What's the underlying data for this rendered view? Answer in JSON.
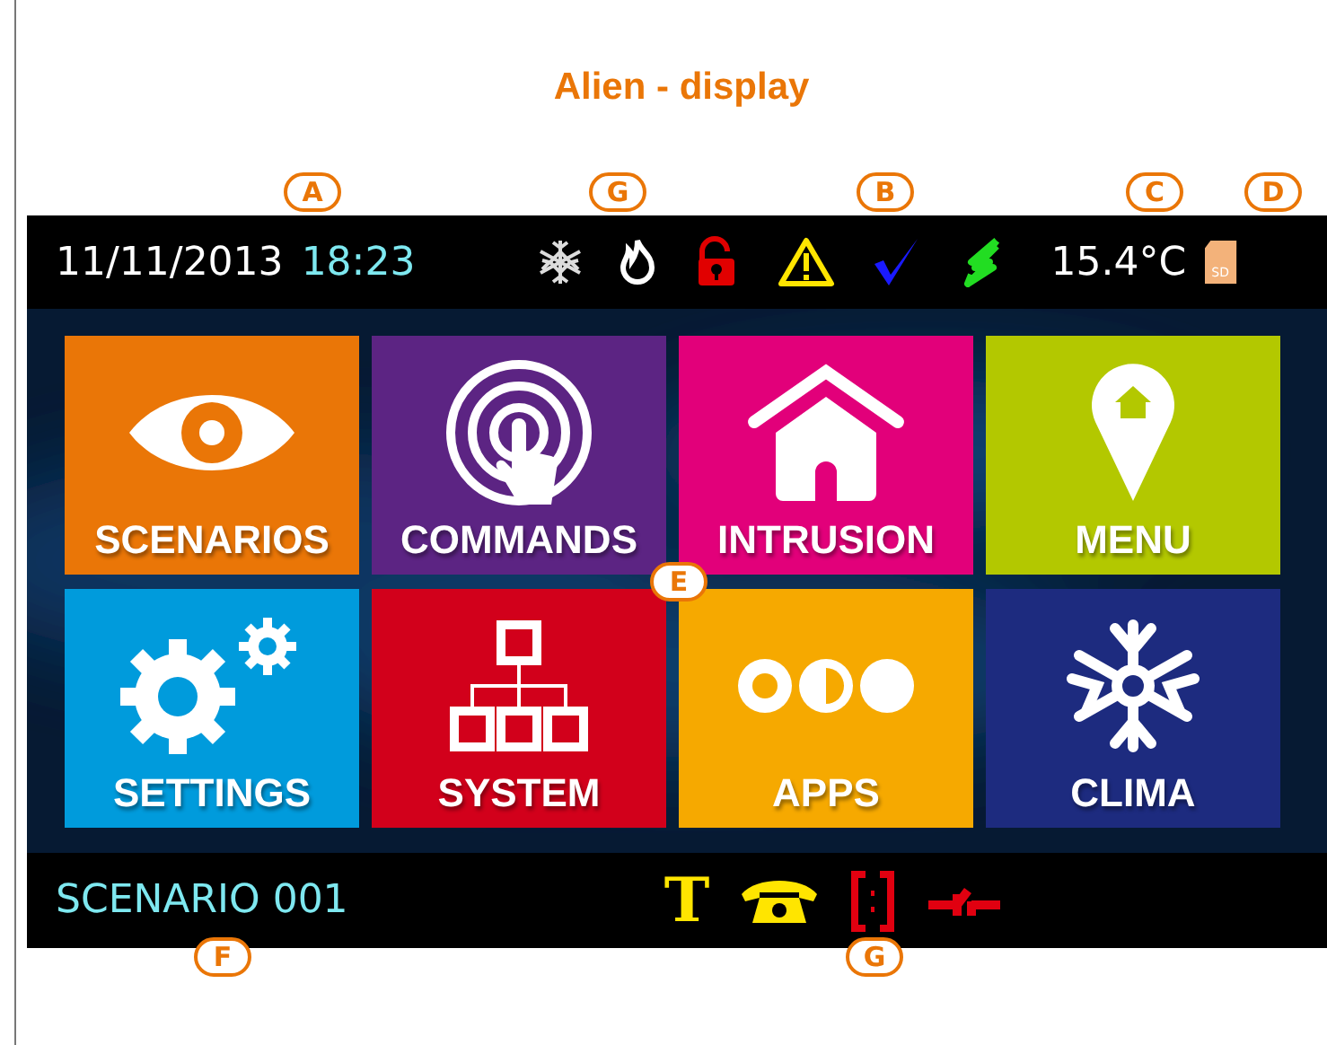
{
  "title": "Alien - display",
  "top_bar": {
    "date": "11/11/2013",
    "time": "18:23",
    "status_icons": [
      {
        "kind": "frost"
      },
      {
        "kind": "flame"
      },
      {
        "kind": "padlock"
      },
      {
        "kind": "warning"
      },
      {
        "kind": "check"
      },
      {
        "kind": "power"
      }
    ],
    "temperature": "15.4°C",
    "sd_label": "SD"
  },
  "tiles": [
    {
      "label": "SCENARIOS",
      "kind": "eye",
      "color": "#ea7607"
    },
    {
      "label": "COMMANDS",
      "kind": "touch",
      "color": "#5c2483"
    },
    {
      "label": "INTRUSION",
      "kind": "house",
      "color": "#e2007a"
    },
    {
      "label": "MENU",
      "kind": "pin",
      "color": "#b3c800"
    },
    {
      "label": "SETTINGS",
      "kind": "gears",
      "color": "#009bdc"
    },
    {
      "label": "SYSTEM",
      "kind": "network",
      "color": "#d2001b"
    },
    {
      "label": "APPS",
      "kind": "dots",
      "color": "#f6a900"
    },
    {
      "label": "CLIMA",
      "kind": "snowflake",
      "color": "#1d2b7f"
    }
  ],
  "bottom_bar": {
    "scenario": "SCENARIO 001",
    "text_icon": "T",
    "status_icons": [
      {
        "kind": "phone"
      },
      {
        "kind": "bracket"
      },
      {
        "kind": "valve"
      }
    ]
  },
  "callouts": [
    {
      "letter": "A"
    },
    {
      "letter": "G"
    },
    {
      "letter": "B"
    },
    {
      "letter": "C"
    },
    {
      "letter": "D"
    },
    {
      "letter": "E"
    },
    {
      "letter": "F"
    },
    {
      "letter": "G"
    }
  ]
}
